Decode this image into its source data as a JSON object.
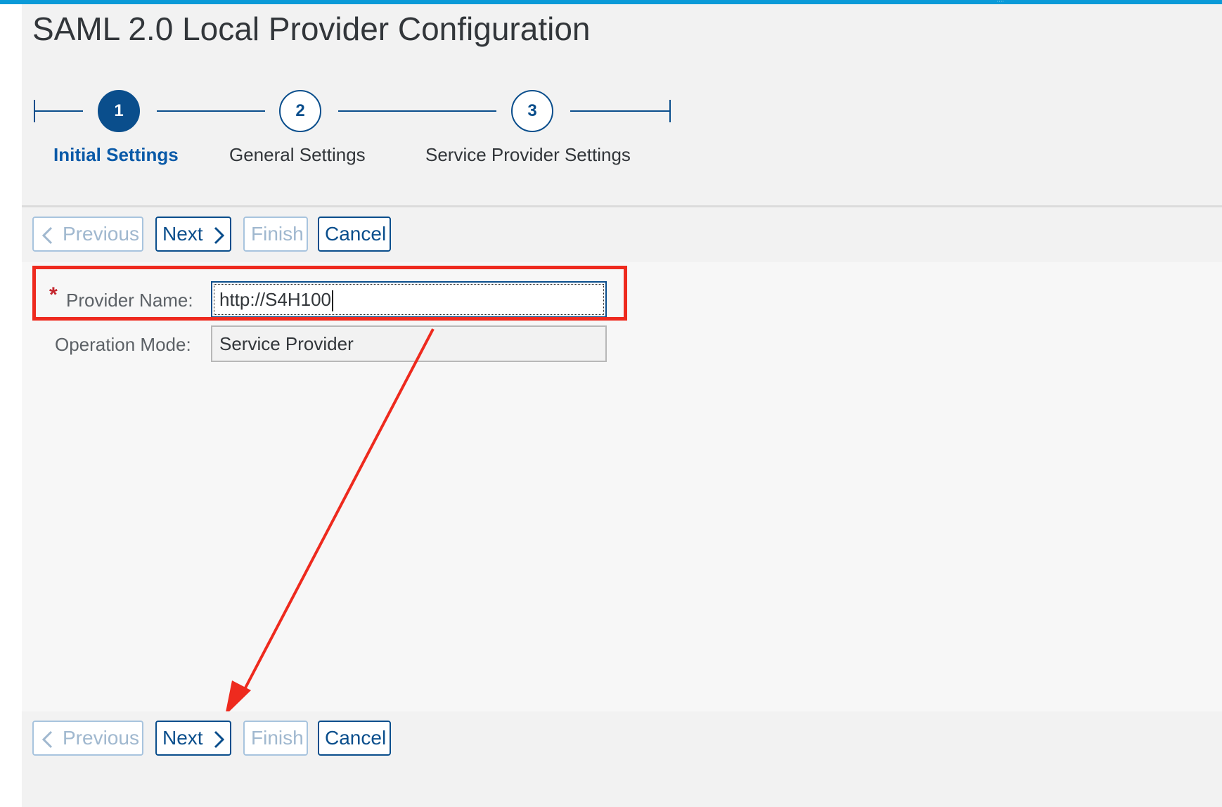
{
  "page": {
    "title": "SAML 2.0 Local Provider Configuration"
  },
  "wizard": {
    "steps": [
      {
        "number": "1",
        "label": "Initial Settings",
        "state": "active"
      },
      {
        "number": "2",
        "label": "General Settings",
        "state": "inactive"
      },
      {
        "number": "3",
        "label": "Service Provider Settings",
        "state": "inactive"
      }
    ]
  },
  "toolbar": {
    "previous_label": "Previous",
    "next_label": "Next",
    "finish_label": "Finish",
    "cancel_label": "Cancel"
  },
  "form": {
    "provider_name": {
      "label": "Provider Name:",
      "value": "http://S4H100",
      "required": true,
      "required_marker": "*"
    },
    "operation_mode": {
      "label": "Operation Mode:",
      "value": "Service Provider"
    }
  },
  "icons": {
    "previous": "chevron-left-icon",
    "next": "chevron-right-icon"
  },
  "colors": {
    "accent_bar": "#0a9ad8",
    "primary": "#0a4e8c",
    "annotation": "#ee2a1e",
    "required": "#c4262e"
  }
}
